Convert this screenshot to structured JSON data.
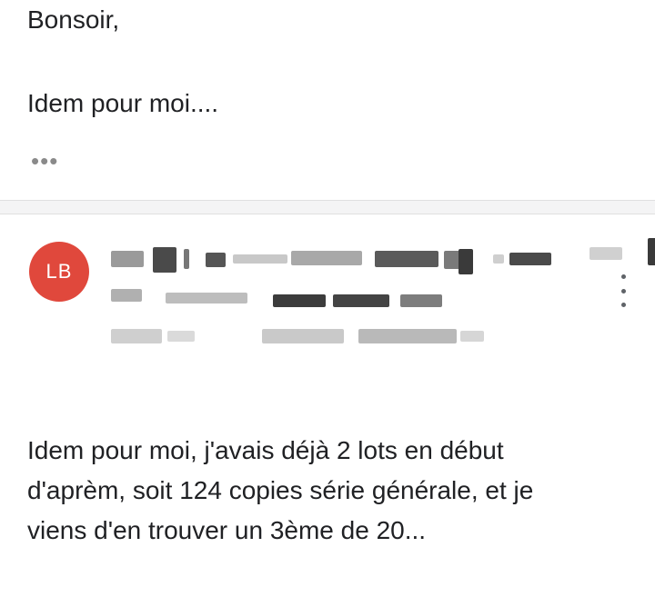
{
  "previous_message": {
    "greeting": "Bonsoir,",
    "body": "Idem pour moi....",
    "trimmed_content_label": "•••"
  },
  "reply": {
    "avatar_initials": "LB",
    "avatar_color": "#e0483c",
    "body_lines": [
      "Idem pour moi, j'avais déjà 2 lots en début",
      "d'aprèm, soit 124 copies série générale, et je",
      "viens d'en trouver un 3ème  de 20..."
    ]
  },
  "icons": {
    "more_options": "more-vert-icon"
  }
}
